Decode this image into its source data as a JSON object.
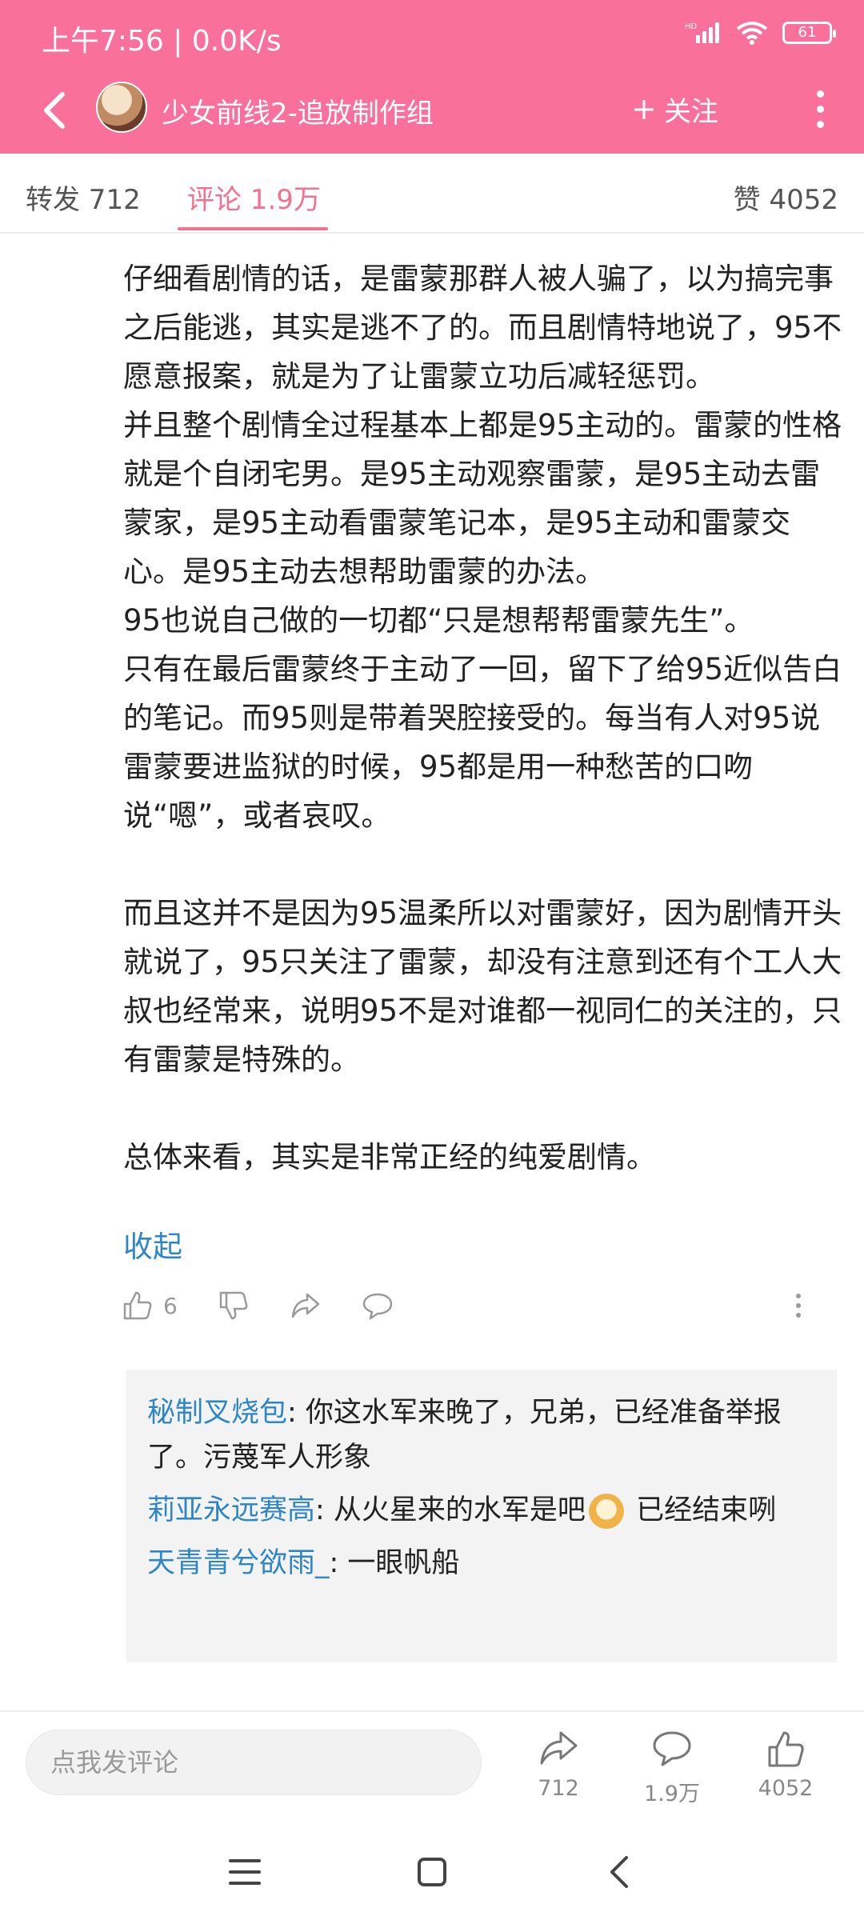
{
  "status_bar": {
    "time": "上午7:56 | 0.0K/s",
    "battery": "61",
    "network_badge": "HD"
  },
  "topbar": {
    "title": "少女前线2-追放制作组",
    "follow_label": "关注",
    "follow_icon": "plus-icon"
  },
  "tabs": {
    "repost": "转发 712",
    "comment": "评论 1.9万",
    "like": "赞 4052",
    "active": "comment"
  },
  "comment": {
    "paragraphs": [
      "仔细看剧情的话，是雷蒙那群人被人骗了，以为搞完事之后能逃，其实是逃不了的。而且剧情特地说了，95不愿意报案，就是为了让雷蒙立功后减轻惩罚。",
      "并且整个剧情全过程基本上都是95主动的。雷蒙的性格就是个自闭宅男。是95主动观察雷蒙，是95主动去雷蒙家，是95主动看雷蒙笔记本，是95主动和雷蒙交心。是95主动去想帮助雷蒙的办法。",
      "95也说自己做的一切都“只是想帮帮雷蒙先生”。",
      "只有在最后雷蒙终于主动了一回，留下了给95近似告白的笔记。而95则是带着哭腔接受的。每当有人对95说雷蒙要进监狱的时候，95都是用一种愁苦的口吻说“嗯”，或者哀叹。",
      "",
      "而且这并不是因为95温柔所以对雷蒙好，因为剧情开头就说了，95只关注了雷蒙，却没有注意到还有个工人大叔也经常来，说明95不是对谁都一视同仁的关注的，只有雷蒙是特殊的。",
      "",
      "总体来看，其实是非常正经的纯爱剧情。"
    ],
    "collapse_label": "收起",
    "like_count": "6"
  },
  "replies": [
    {
      "name": "秘制叉烧包",
      "text": ": 你这水军来晚了，兄弟，已经准备举报了。污蔑军人形象",
      "emoji": null
    },
    {
      "name": "莉亚永远赛高",
      "text": ": 从火星来的水军是吧",
      "emoji": "doge-emoji",
      "text_after": " 已经结束咧"
    },
    {
      "name": "天青青兮欲雨_",
      "text": ": 一眼帆船",
      "emoji": null
    }
  ],
  "bottom_bar": {
    "input_placeholder": "点我发评论",
    "share_count": "712",
    "comment_count": "1.9万",
    "like_count": "4052"
  },
  "colors": {
    "header_bg": "#f9709a",
    "accent": "#f4708f",
    "link": "#2f86c6"
  }
}
